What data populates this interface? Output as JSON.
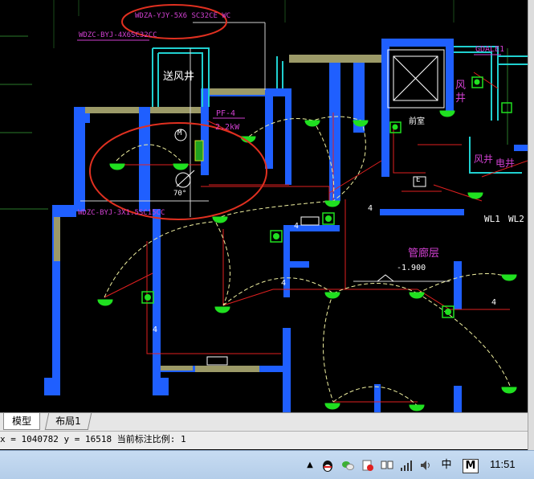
{
  "drawing": {
    "labels": {
      "cable_top": "WDZA-YJY-5X6 SC32CE WC",
      "cable_second": "WDZC-BYJ-4X6SC32CC",
      "cable_left": "WDZC-BYJ-3X1.5SC15CC",
      "air_shaft_1": "送风井",
      "panel_pf": "PF-4",
      "panel_power": "2.2kW",
      "angle": "70°",
      "panel_gdale": "GDALE1",
      "shaft_right_a": "风",
      "shaft_right_b": "井",
      "room_front": "前室",
      "shaft_bottom": "风井",
      "elevator": "电井",
      "corridor": "管廊层",
      "elevation": "-1.900",
      "wl1": "WL1",
      "wl2": "WL2",
      "box_e": "E",
      "motor_m": "M",
      "count_4": "4"
    }
  },
  "tabs": {
    "model": "模型",
    "layout1": "布局1"
  },
  "command_line": {
    "text": "x = 1040782 y = 16518 当前标注比例: 1"
  },
  "taskbar": {
    "clock": "11:51",
    "icons": [
      "qq-icon",
      "wechat-icon",
      "security-icon",
      "network-icon",
      "signal-icon",
      "volume-icon",
      "input-method-icon",
      "ime-m-icon"
    ],
    "ime_label": "中",
    "ime_m": "M"
  }
}
